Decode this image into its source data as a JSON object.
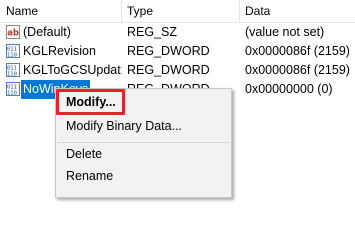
{
  "columns": {
    "name": "Name",
    "type": "Type",
    "data": "Data"
  },
  "rows": [
    {
      "icon": "string-value-icon",
      "name": "(Default)",
      "type": "REG_SZ",
      "data": "(value not set)"
    },
    {
      "icon": "binary-value-icon",
      "name": "KGLRevision",
      "type": "REG_DWORD",
      "data": "0x0000086f (2159)"
    },
    {
      "icon": "binary-value-icon",
      "name": "KGLToGCSUpdat...",
      "type": "REG_DWORD",
      "data": "0x0000086f (2159)"
    },
    {
      "icon": "binary-value-icon",
      "name": "NoWinKeys",
      "type": "REG_DWORD",
      "data": "0x00000000 (0)"
    }
  ],
  "context_menu": {
    "modify": "Modify...",
    "modify_binary": "Modify Binary Data...",
    "delete": "Delete",
    "rename": "Rename"
  },
  "colors": {
    "selection": "#0078d7",
    "highlight_border": "#e0262b",
    "menu_background": "#f2f2f2"
  }
}
